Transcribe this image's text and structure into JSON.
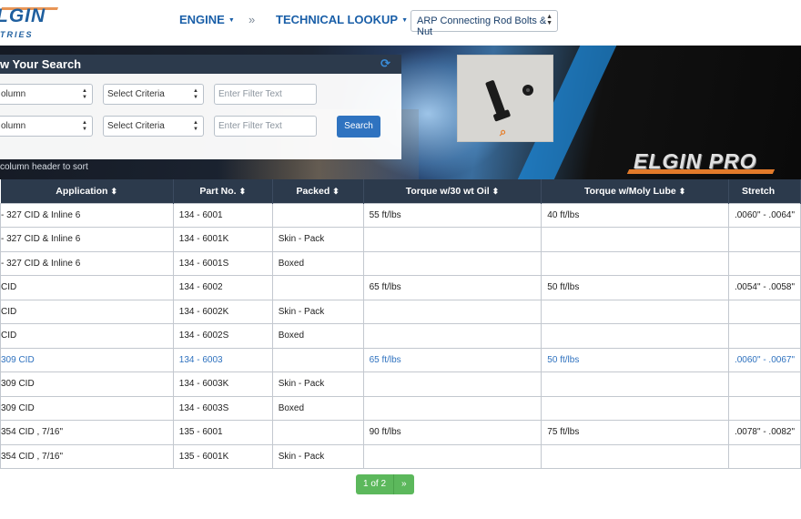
{
  "brand": {
    "wordmark": "LGIN",
    "subtitle": "TRIES"
  },
  "nav": {
    "engine": "ENGINE",
    "separator": "»",
    "technical_lookup": "TECHNICAL LOOKUP",
    "product_select": "ARP Connecting Rod Bolts & Nut"
  },
  "search_panel": {
    "title": "w Your Search",
    "rows": [
      {
        "column": "olumn",
        "criteria": "Select Criteria",
        "filter_placeholder": "Enter Filter Text"
      },
      {
        "column": "olumn",
        "criteria": "Select Criteria",
        "filter_placeholder": "Enter Filter Text"
      }
    ],
    "search_button": "Search",
    "sort_hint": "column header to sort"
  },
  "banner": {
    "pro_logo": "ELGIN PRO"
  },
  "table": {
    "headers": [
      "Application",
      "Part No.",
      "Packed",
      "Torque w/30 wt Oil",
      "Torque w/Moly Lube",
      "Stretch"
    ],
    "rows": [
      {
        "application": "- 327 CID & Inline 6",
        "part_no": "134 - 6001",
        "packed": "",
        "torque_oil": "55 ft/lbs",
        "torque_moly": "40 ft/lbs",
        "stretch": ".0060\" - .0064\"",
        "highlight": false
      },
      {
        "application": "- 327 CID & Inline 6",
        "part_no": "134 - 6001K",
        "packed": "Skin - Pack",
        "torque_oil": "",
        "torque_moly": "",
        "stretch": "",
        "highlight": false
      },
      {
        "application": "- 327 CID & Inline 6",
        "part_no": "134 - 6001S",
        "packed": "Boxed",
        "torque_oil": "",
        "torque_moly": "",
        "stretch": "",
        "highlight": false
      },
      {
        "application": "CID",
        "part_no": "134 - 6002",
        "packed": "",
        "torque_oil": "65 ft/lbs",
        "torque_moly": "50 ft/lbs",
        "stretch": ".0054\" - .0058\"",
        "highlight": false
      },
      {
        "application": "CID",
        "part_no": "134 - 6002K",
        "packed": "Skin - Pack",
        "torque_oil": "",
        "torque_moly": "",
        "stretch": "",
        "highlight": false
      },
      {
        "application": "CID",
        "part_no": "134 - 6002S",
        "packed": "Boxed",
        "torque_oil": "",
        "torque_moly": "",
        "stretch": "",
        "highlight": false
      },
      {
        "application": "309 CID",
        "part_no": "134 - 6003",
        "packed": "",
        "torque_oil": "65 ft/lbs",
        "torque_moly": "50 ft/lbs",
        "stretch": ".0060\" - .0067\"",
        "highlight": true
      },
      {
        "application": "309 CID",
        "part_no": "134 - 6003K",
        "packed": "Skin - Pack",
        "torque_oil": "",
        "torque_moly": "",
        "stretch": "",
        "highlight": false
      },
      {
        "application": "309 CID",
        "part_no": "134 - 6003S",
        "packed": "Boxed",
        "torque_oil": "",
        "torque_moly": "",
        "stretch": "",
        "highlight": false
      },
      {
        "application": "354 CID , 7/16\"",
        "part_no": "135 - 6001",
        "packed": "",
        "torque_oil": "90 ft/lbs",
        "torque_moly": "75 ft/lbs",
        "stretch": ".0078\" - .0082\"",
        "highlight": false
      },
      {
        "application": "354 CID , 7/16\"",
        "part_no": "135 - 6001K",
        "packed": "Skin - Pack",
        "torque_oil": "",
        "torque_moly": "",
        "stretch": "",
        "highlight": false
      }
    ]
  },
  "pagination": {
    "current": "1 of 2",
    "next": "»"
  },
  "colors": {
    "nav": "#1a5fa8",
    "header_bg": "#2c3a4c",
    "highlight_row": "#2f72bf",
    "pager": "#5cb85c",
    "search_button": "#2f73c0"
  },
  "icons": {
    "refresh": "refresh-icon",
    "zoom": "zoom-icon",
    "sort": "sort-icon"
  }
}
